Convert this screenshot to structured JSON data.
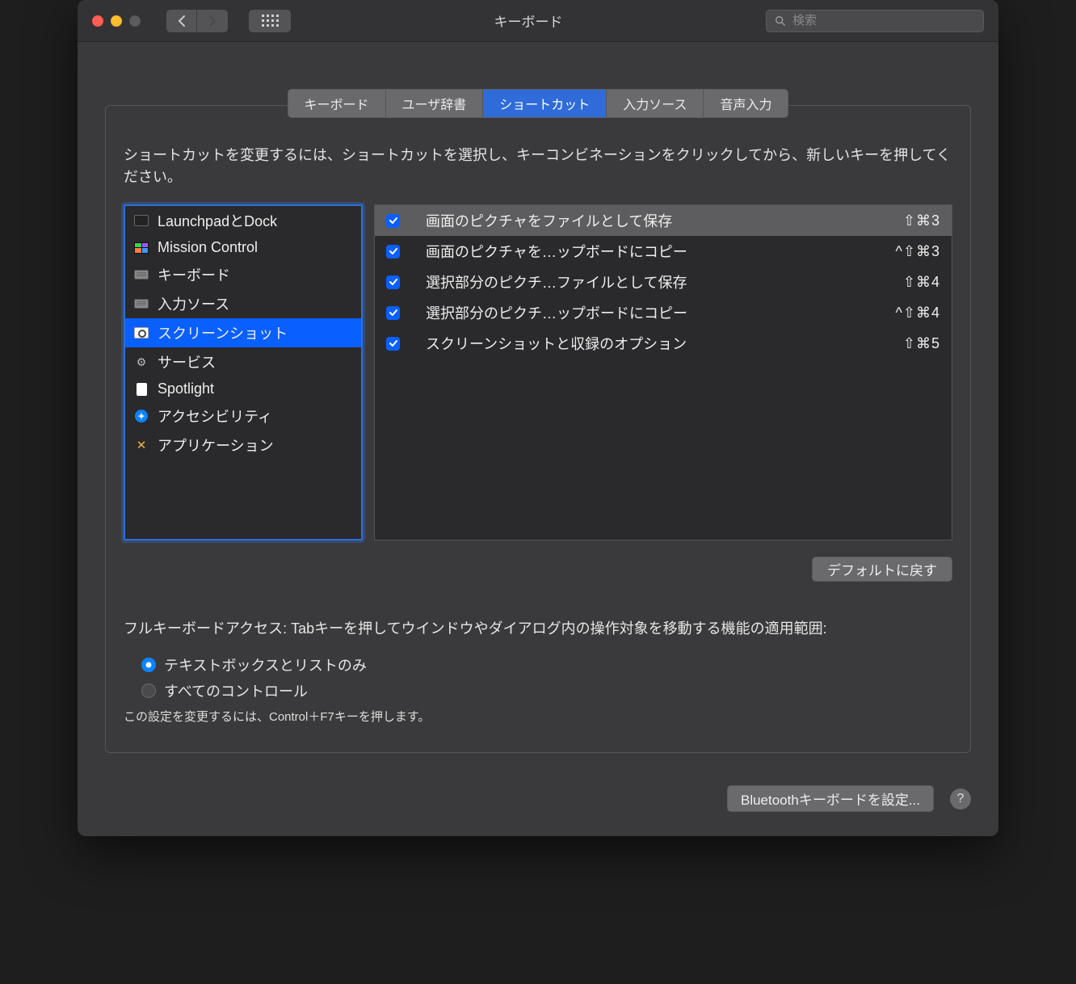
{
  "window": {
    "title": "キーボード",
    "search_placeholder": "検索"
  },
  "tabs": [
    {
      "label": "キーボード"
    },
    {
      "label": "ユーザ辞書"
    },
    {
      "label": "ショートカット"
    },
    {
      "label": "入力ソース"
    },
    {
      "label": "音声入力"
    }
  ],
  "active_tab_index": 2,
  "instructions": "ショートカットを変更するには、ショートカットを選択し、キーコンビネーションをクリックしてから、新しいキーを押してください。",
  "sidebar": {
    "items": [
      {
        "label": "LaunchpadとDock",
        "icon": "launchpad"
      },
      {
        "label": "Mission Control",
        "icon": "mission-control"
      },
      {
        "label": "キーボード",
        "icon": "keyboard"
      },
      {
        "label": "入力ソース",
        "icon": "keyboard"
      },
      {
        "label": "スクリーンショット",
        "icon": "camera"
      },
      {
        "label": "サービス",
        "icon": "gear"
      },
      {
        "label": "Spotlight",
        "icon": "doc"
      },
      {
        "label": "アクセシビリティ",
        "icon": "accessibility"
      },
      {
        "label": "アプリケーション",
        "icon": "app"
      }
    ],
    "selected_index": 4
  },
  "shortcuts": [
    {
      "enabled": true,
      "label": "画面のピクチャをファイルとして保存",
      "keys": "⇧⌘3",
      "highlight": true
    },
    {
      "enabled": true,
      "label": "画面のピクチャを…ップボードにコピー",
      "keys": "^⇧⌘3"
    },
    {
      "enabled": true,
      "label": "選択部分のピクチ…ファイルとして保存",
      "keys": "⇧⌘4"
    },
    {
      "enabled": true,
      "label": "選択部分のピクチ…ップボードにコピー",
      "keys": "^⇧⌘4"
    },
    {
      "enabled": true,
      "label": "スクリーンショットと収録のオプション",
      "keys": "⇧⌘5"
    }
  ],
  "restore_button": "デフォルトに戻す",
  "fka": {
    "heading": "フルキーボードアクセス: Tabキーを押してウインドウやダイアログ内の操作対象を移動する機能の適用範囲:",
    "options": [
      {
        "label": "テキストボックスとリストのみ",
        "selected": true
      },
      {
        "label": "すべてのコントロール",
        "selected": false
      }
    ],
    "hint": "この設定を変更するには、Control＋F7キーを押します。"
  },
  "footer": {
    "bluetooth_button": "Bluetoothキーボードを設定..."
  }
}
